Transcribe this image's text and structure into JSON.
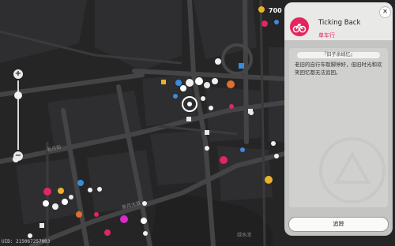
{
  "map": {
    "street_labels": [
      "新月街",
      "新月大道",
      "绿水湾"
    ],
    "zoom_in": "+",
    "zoom_out": "−",
    "uid": "UID: 215067257003",
    "top_counter": "700",
    "colors": {
      "road": "#3c3c3e",
      "building": "#2b2b2d",
      "water": "#252526",
      "accent": "#e3265e"
    }
  },
  "panel": {
    "title": "Ticking Back",
    "subtitle": "单车行",
    "tag": "『旧子余线忆』",
    "description": "老旧的自行车歇脚停好，但旧时光和欢笑回忆都无法追回。",
    "track_button": "追踪",
    "close_icon": "close-icon",
    "icon": "bicycle-icon"
  }
}
